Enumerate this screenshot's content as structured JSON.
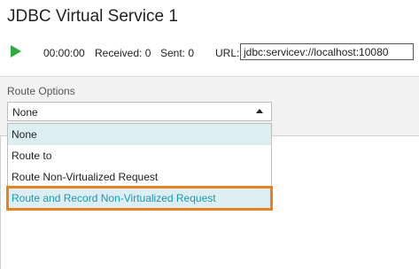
{
  "title": "JDBC Virtual Service 1",
  "toolbar": {
    "timer": "00:00:00",
    "received": "Received: 0",
    "sent": "Sent: 0",
    "url_label": "URL:",
    "url_value": "jdbc:servicev://localhost:10080"
  },
  "route": {
    "label": "Route Options",
    "selected": "None",
    "options": [
      "None",
      "Route to",
      "Route Non-Virtualized Request",
      "Route and Record Non-Virtualized Request"
    ]
  },
  "colors": {
    "play": "#2eab3e",
    "highlight_border": "#e8821e",
    "highlight_text": "#1a9aa8",
    "selected_bg": "#ddeef3"
  },
  "icons": [
    "play-icon",
    "chevron-up-icon"
  ]
}
